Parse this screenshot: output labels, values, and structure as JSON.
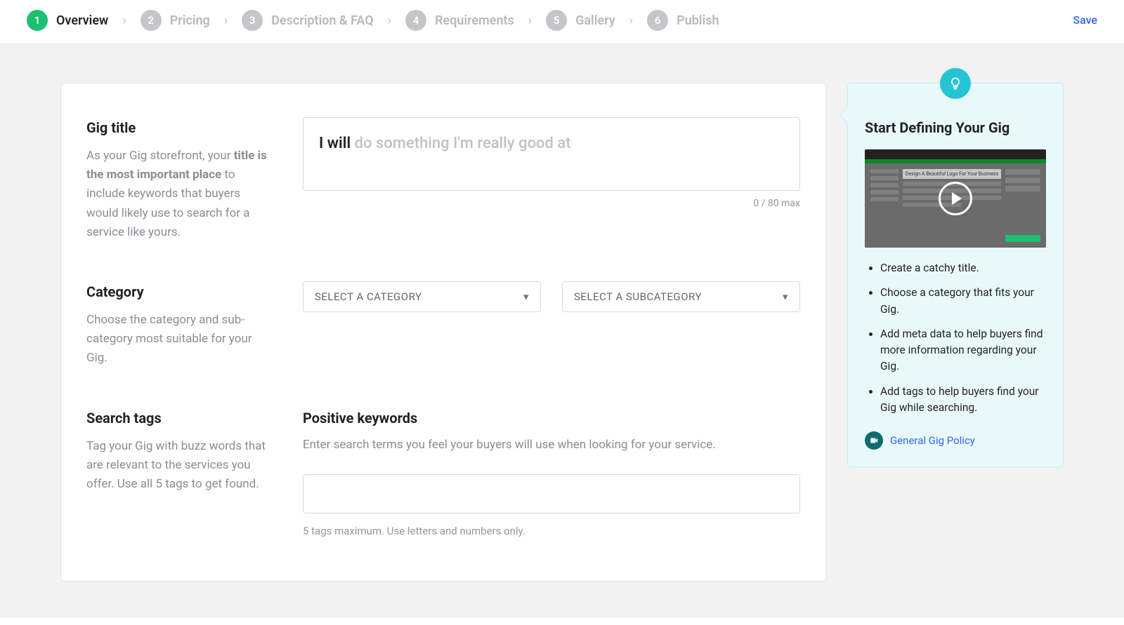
{
  "nav": {
    "steps": [
      {
        "num": "1",
        "label": "Overview",
        "active": true
      },
      {
        "num": "2",
        "label": "Pricing",
        "active": false
      },
      {
        "num": "3",
        "label": "Description & FAQ",
        "active": false
      },
      {
        "num": "4",
        "label": "Requirements",
        "active": false
      },
      {
        "num": "5",
        "label": "Gallery",
        "active": false
      },
      {
        "num": "6",
        "label": "Publish",
        "active": false
      }
    ],
    "save": "Save"
  },
  "gigTitle": {
    "label": "Gig title",
    "desc_pre": "As your Gig storefront, your ",
    "desc_bold": "title is the most important place",
    "desc_post": " to include keywords that buyers would likely use to search for a service like yours.",
    "prefix": "I will",
    "placeholder": "do something I'm really good at",
    "count": "0 / 80 max"
  },
  "category": {
    "label": "Category",
    "desc": "Choose the category and sub-category most suitable for your Gig.",
    "select1": "SELECT A CATEGORY",
    "select2": "SELECT A SUBCATEGORY"
  },
  "tags": {
    "label": "Search tags",
    "desc": "Tag your Gig with buzz words that are relevant to the services you offer. Use all 5 tags to get found.",
    "positive_label": "Positive keywords",
    "positive_desc": "Enter search terms you feel your buyers will use when looking for your service.",
    "hint": "5 tags maximum. Use letters and numbers only."
  },
  "tip": {
    "title": "Start Defining Your Gig",
    "video_caption": "Design A Beautiful Logo For Your Business",
    "bullets": [
      "Create a catchy title.",
      "Choose a category that fits your Gig.",
      "Add meta data to help buyers find more information regarding your Gig.",
      "Add tags to help buyers find your Gig while searching."
    ],
    "policy": "General Gig Policy"
  }
}
